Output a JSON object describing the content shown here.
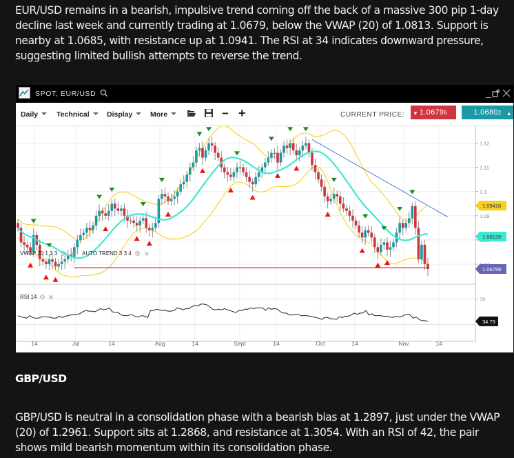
{
  "article": {
    "paragraph1": "EUR/USD remains in a bearish, impulsive trend coming off the back of a massive 300 pip 1-day decline last week and currently trading at 1.0679, below the VWAP (20) of 1.0813. Support is nearby at 1.0685, with resistance up at 1.0941. The RSI at 34 indicates downward pressure, suggesting limited bullish attempts to reverse the trend.",
    "heading2": "GBP/USD",
    "paragraph2": "GBP/USD is neutral in a consolidation phase with a bearish bias at 1.2897, just under the VWAP (20) of 1.2961. Support sits at 1.2868, and resistance at 1.3054. With an RSI of 42, the pair shows mild bearish momentum within its consolidation phase."
  },
  "widget": {
    "title": "SPOT, EUR/USD",
    "icons": {
      "logo": "line-chart-icon",
      "search": "search-icon",
      "minimize": "minimize-icon",
      "popout": "popout-icon",
      "close": "close-icon"
    },
    "toolbar": {
      "menus": [
        "Daily",
        "Technical",
        "Display",
        "More"
      ],
      "open_icon": "folder-open-icon",
      "save_icon": "save-icon",
      "zoom_out": "−",
      "zoom_in": "+"
    },
    "current_price_label": "CURRENT PRICE:",
    "bid": {
      "main": "1.0679",
      "pip": "6"
    },
    "ask": {
      "main": "1.0680",
      "pip": "2"
    },
    "colors": {
      "bid": "#d0343f",
      "ask": "#1a9aa5",
      "up_candle": "#1a9aa5",
      "down_candle": "#d0343f",
      "vwap": "#3de8d0",
      "bands": "#f5d020",
      "trendline": "#4a7fd8",
      "support": "#e01010"
    }
  },
  "chart_data": [
    {
      "type": "candlestick",
      "title": "SPOT, EUR/USD",
      "indicators": [
        {
          "name": "VWAP",
          "params": "20 1 2 3",
          "label": "VWAP 20 1 2 3"
        },
        {
          "name": "AUTO TREND",
          "params": "3 3 4",
          "label": "AUTO TREND 3 3 4"
        }
      ],
      "x_ticks": [
        "14",
        "Jul",
        "14",
        "Aug",
        "14",
        "Sept",
        "14",
        "Oct",
        "14",
        "Nov",
        "14"
      ],
      "y_ticks": [
        "1.12",
        "1.11",
        "1.1",
        "1.09",
        "1.08",
        "1.07"
      ],
      "ylim": [
        1.062,
        1.127
      ],
      "price_tags": [
        {
          "label": "upper-band",
          "value": "1.09418",
          "color": "#f5d020"
        },
        {
          "label": "vwap",
          "value": "1.08139",
          "color": "#3de8d0"
        },
        {
          "label": "last",
          "value": "1.06799",
          "color": "#6666b8"
        }
      ],
      "support_level": 1.0685,
      "trendline": {
        "from": [
          1.1215,
          "Oct"
        ],
        "to": [
          1.0935,
          "Nov 14"
        ]
      },
      "closes": [
        1.085,
        1.079,
        1.078,
        1.077,
        1.075,
        1.082,
        1.078,
        1.072,
        1.071,
        1.07,
        1.072,
        1.071,
        1.069,
        1.07,
        1.071,
        1.072,
        1.074,
        1.073,
        1.077,
        1.08,
        1.082,
        1.083,
        1.085,
        1.084,
        1.086,
        1.09,
        1.092,
        1.091,
        1.09,
        1.092,
        1.095,
        1.093,
        1.092,
        1.093,
        1.09,
        1.088,
        1.088,
        1.087,
        1.086,
        1.088,
        1.089,
        1.085,
        1.084,
        1.085,
        1.087,
        1.097,
        1.099,
        1.098,
        1.096,
        1.097,
        1.098,
        1.1,
        1.103,
        1.104,
        1.107,
        1.11,
        1.112,
        1.117,
        1.118,
        1.114,
        1.117,
        1.12,
        1.119,
        1.116,
        1.114,
        1.11,
        1.108,
        1.107,
        1.106,
        1.108,
        1.11,
        1.11,
        1.108,
        1.106,
        1.104,
        1.103,
        1.106,
        1.108,
        1.11,
        1.112,
        1.114,
        1.116,
        1.116,
        1.112,
        1.116,
        1.119,
        1.118,
        1.12,
        1.117,
        1.115,
        1.117,
        1.119,
        1.12,
        1.116,
        1.111,
        1.108,
        1.105,
        1.102,
        1.098,
        1.096,
        1.097,
        1.099,
        1.098,
        1.095,
        1.093,
        1.092,
        1.09,
        1.088,
        1.086,
        1.083,
        1.081,
        1.084,
        1.083,
        1.081,
        1.077,
        1.075,
        1.078,
        1.079,
        1.076,
        1.077,
        1.079,
        1.083,
        1.087,
        1.085,
        1.087,
        1.089,
        1.094,
        1.085,
        1.072,
        1.078,
        1.07,
        1.068
      ]
    },
    {
      "type": "line",
      "title": "RSI 14",
      "label": "RSI 14",
      "y_ticks": [
        "70"
      ],
      "ylim": [
        10,
        90
      ],
      "last_value_tag": "34.79",
      "values": [
        44,
        42,
        41,
        40,
        44,
        41,
        40,
        40,
        42,
        42,
        42,
        41,
        40,
        40,
        43,
        41,
        43,
        44,
        45,
        46,
        46,
        47,
        50,
        52,
        51,
        51,
        50,
        52,
        55,
        53,
        54,
        56,
        50,
        49,
        49,
        45,
        44,
        44,
        45,
        45,
        42,
        42,
        44,
        43,
        41,
        52,
        52,
        54,
        53,
        52,
        52,
        51,
        51,
        52,
        56,
        55,
        53,
        55,
        55,
        58,
        60,
        59,
        62,
        62,
        61,
        58,
        54,
        53,
        54,
        53,
        55,
        53,
        52,
        50,
        49,
        52,
        52,
        54,
        54,
        56,
        55,
        56,
        56,
        56,
        52,
        56,
        54,
        55,
        54,
        50,
        48,
        48,
        45,
        45,
        46,
        46,
        44,
        44,
        44,
        43,
        42,
        41,
        40,
        38,
        41,
        41,
        39,
        39,
        38,
        42,
        41,
        43,
        43,
        45,
        48,
        46,
        48,
        48,
        52,
        45,
        47,
        44,
        44,
        44,
        43,
        43,
        42,
        41,
        43,
        42,
        42,
        45,
        46,
        45,
        40,
        42,
        38,
        36,
        36,
        35
      ]
    }
  ]
}
